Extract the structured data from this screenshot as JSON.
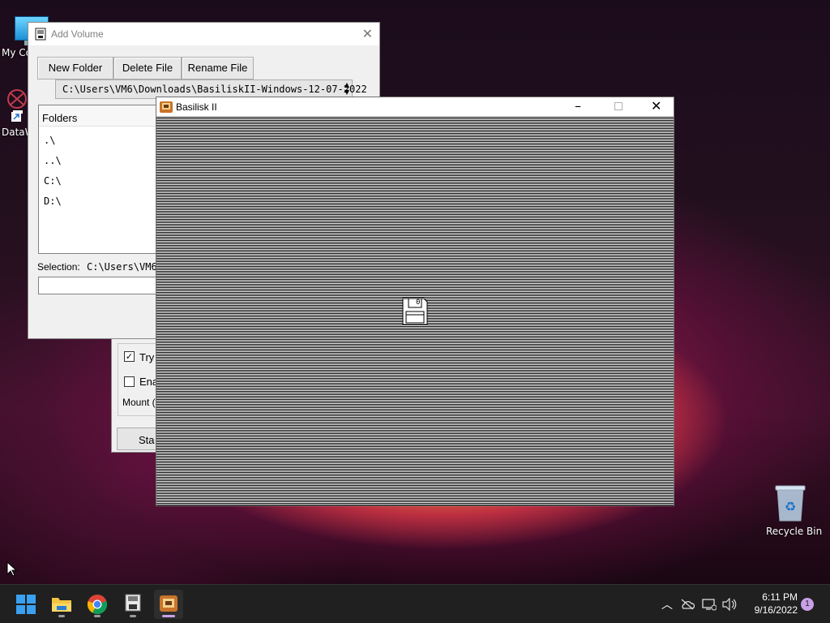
{
  "desktop": {
    "icons": {
      "my_computer": "My Co",
      "datawin": "DataW",
      "recycle_bin": "Recycle Bin"
    }
  },
  "add_volume": {
    "title": "Add Volume",
    "buttons": {
      "new_folder": "New Folder",
      "delete_file": "Delete File",
      "rename_file": "Rename File"
    },
    "path": "C:\\Users\\VM6\\Downloads\\BasiliskII-Windows-12-07-2022",
    "folders_header": "Folders",
    "folders": [
      ".\\",
      "..\\",
      "C:\\",
      "D:\\"
    ],
    "selection_label": "Selection:",
    "selection_value": "C:\\Users\\VM6\\",
    "filename_value": ""
  },
  "behind_window": {
    "check1_label": "Try",
    "check1_checked": true,
    "check2_label": "Ena",
    "check2_checked": false,
    "mount_label": "Mount (",
    "start_label": "Sta"
  },
  "basilisk": {
    "title": "Basilisk II",
    "floppy_label": "0"
  },
  "taskbar": {
    "time": "6:11 PM",
    "date": "9/16/2022",
    "notification_count": "1"
  },
  "colors": {
    "accent": "#0078d4",
    "taskbar": "#202020",
    "badge": "#c8a0e8"
  }
}
